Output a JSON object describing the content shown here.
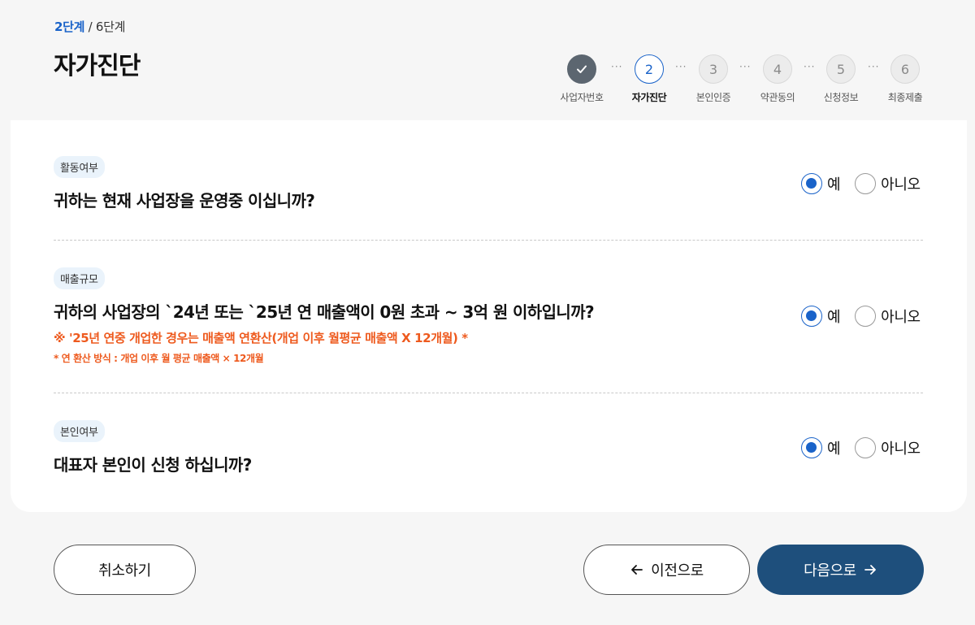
{
  "header": {
    "step_current": "2단계",
    "step_total": " / 6단계",
    "title": "자가진단"
  },
  "stepper": {
    "steps": [
      {
        "number": "",
        "label": "사업자번호",
        "state": "done"
      },
      {
        "number": "2",
        "label": "자가진단",
        "state": "active"
      },
      {
        "number": "3",
        "label": "본인인증",
        "state": "pending"
      },
      {
        "number": "4",
        "label": "약관동의",
        "state": "pending"
      },
      {
        "number": "5",
        "label": "신청정보",
        "state": "pending"
      },
      {
        "number": "6",
        "label": "최종제출",
        "state": "pending"
      }
    ],
    "separator": "···"
  },
  "questions": [
    {
      "tag": "활동여부",
      "text": "귀하는 현재 사업장을 운영중 이십니까?",
      "options": [
        "예",
        "아니오"
      ],
      "selected": "예"
    },
    {
      "tag": "매출규모",
      "text": "귀하의 사업장의 `24년 또는 `25년 연 매출액이 0원 초과 ~ 3억 원 이하입니까?",
      "note_main": "※ '25년 연중 개업한 경우는 매출액 연환산(개업 이후 월평균 매출액 X 12개월) *",
      "note_sub": "* 연 환산 방식 : 개업 이후 월 평균 매출액 × 12개월",
      "options": [
        "예",
        "아니오"
      ],
      "selected": "예"
    },
    {
      "tag": "본인여부",
      "text": "대표자 본인이 신청 하십니까?",
      "options": [
        "예",
        "아니오"
      ],
      "selected": "예"
    }
  ],
  "footer": {
    "cancel_label": "취소하기",
    "prev_label": "이전으로",
    "next_label": "다음으로"
  },
  "colors": {
    "accent": "#1a63c9",
    "primary_button": "#1e4f7c",
    "note": "#ee5a1e",
    "done_step": "#5c6670"
  }
}
